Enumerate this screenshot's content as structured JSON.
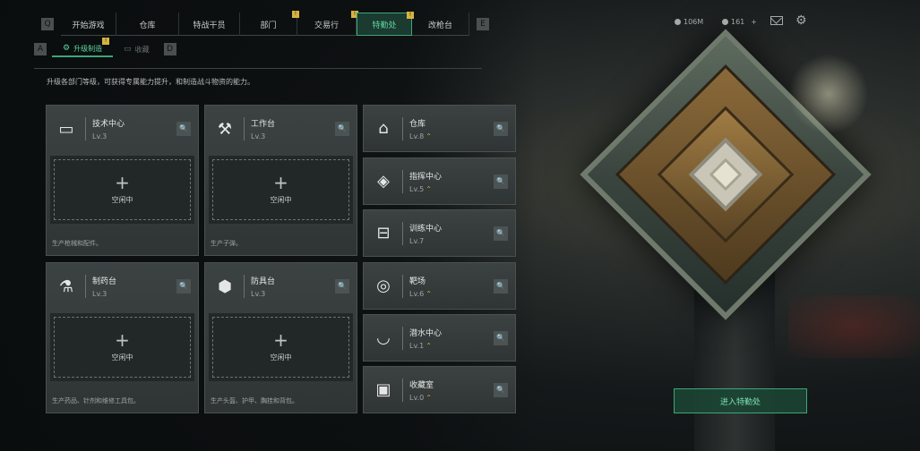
{
  "nav": {
    "tabs": [
      {
        "label": "开始游戏",
        "badge": ""
      },
      {
        "label": "仓库",
        "badge": ""
      },
      {
        "label": "特战干员",
        "badge": ""
      },
      {
        "label": "部门",
        "badge": "!"
      },
      {
        "label": "交易行",
        "badge": "!"
      },
      {
        "label": "特勤处",
        "badge": "!",
        "active": true
      },
      {
        "label": "改枪台",
        "badge": ""
      }
    ],
    "left_key": "Q",
    "right_key": "E"
  },
  "subnav": {
    "left_key": "A",
    "right_key": "D",
    "tabs": [
      {
        "label": "升级制造",
        "badge": "!",
        "active": true
      },
      {
        "label": "收藏",
        "badge": ""
      }
    ]
  },
  "resources": {
    "currency1": "106M",
    "currency2": "161"
  },
  "description": "升级各部门等级，可获得专属能力提升，和制造战斗物资的能力。",
  "workbenches": [
    {
      "name": "技术中心",
      "level": "Lv.3",
      "slot_status": "空闲中",
      "footer": "生产枪械和配件。",
      "icon": "monitor-icon"
    },
    {
      "name": "工作台",
      "level": "Lv.3",
      "slot_status": "空闲中",
      "footer": "生产子弹。",
      "icon": "tools-icon"
    },
    {
      "name": "制药台",
      "level": "Lv.3",
      "slot_status": "空闲中",
      "footer": "生产药品、针剂和维修工具包。",
      "icon": "microscope-icon"
    },
    {
      "name": "防具台",
      "level": "Lv.3",
      "slot_status": "空闲中",
      "footer": "生产头盔、护甲、胸挂和背包。",
      "icon": "armor-icon"
    }
  ],
  "facilities": [
    {
      "name": "仓库",
      "level": "Lv.8",
      "upgradable": true,
      "icon": "warehouse-icon"
    },
    {
      "name": "指挥中心",
      "level": "Lv.5",
      "upgradable": true,
      "icon": "diamond-target-icon"
    },
    {
      "name": "训练中心",
      "level": "Lv.7",
      "upgradable": false,
      "icon": "dumbbell-icon"
    },
    {
      "name": "靶场",
      "level": "Lv.6",
      "upgradable": true,
      "icon": "target-icon"
    },
    {
      "name": "潜水中心",
      "level": "Lv.1",
      "upgradable": true,
      "icon": "diving-mask-icon"
    },
    {
      "name": "收藏室",
      "level": "Lv.0",
      "upgradable": true,
      "icon": "display-case-icon"
    }
  ],
  "enter_button": "进入特勤处",
  "search_glyph": "🔍"
}
